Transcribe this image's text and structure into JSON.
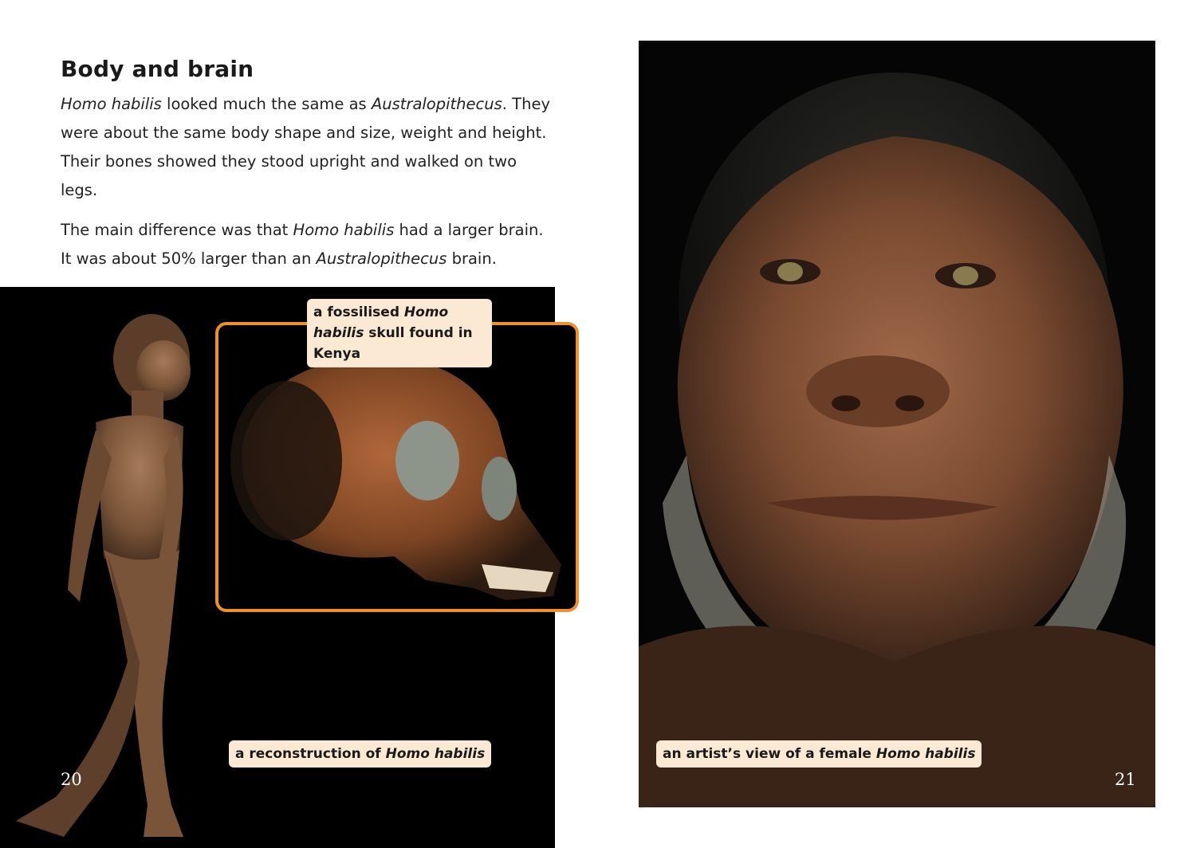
{
  "heading": "Body and brain",
  "paragraph1": {
    "s1": "Homo habilis",
    "s2": " looked much the same as ",
    "s3": "Australopithecus",
    "s4": ". They were about the same body shape and size, weight and height. Their bones showed they stood upright and walked on two legs."
  },
  "paragraph2": {
    "s1": "The main difference was that ",
    "s2": "Homo habilis",
    "s3": " had a larger brain. It was about 50% larger than an ",
    "s4": "Australopithecus",
    "s5": " brain."
  },
  "captions": {
    "skull": {
      "pre": "a fossilised ",
      "em": "Homo habilis",
      "post": " skull found in Kenya"
    },
    "reconstruction": {
      "pre": "a reconstruction of ",
      "em": "Homo habilis"
    },
    "artist": {
      "pre": "an artist’s view of a female ",
      "em": "Homo habilis"
    }
  },
  "page_numbers": {
    "left": "20",
    "right": "21"
  },
  "colors": {
    "inset_border": "#f0902a",
    "caption_bg": "#fbe9d4"
  }
}
